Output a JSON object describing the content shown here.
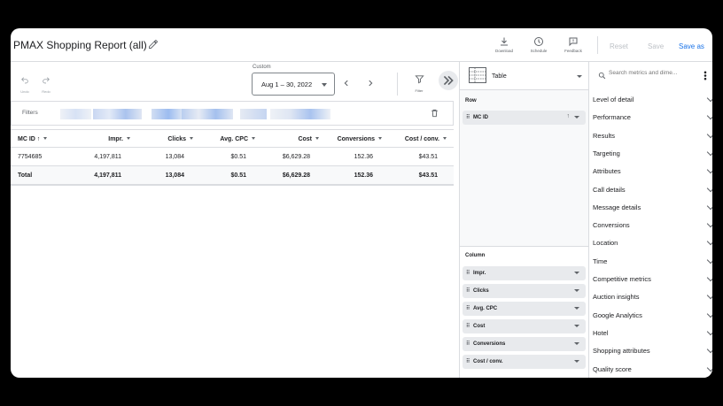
{
  "header": {
    "title": "PMAX Shopping Report (all)",
    "download_label": "Download",
    "schedule_label": "Schedule",
    "feedback_label": "Feedback",
    "reset_label": "Reset",
    "save_label": "Save",
    "save_as_label": "Save as"
  },
  "toolbar": {
    "undo_label": "Undo",
    "redo_label": "Redo",
    "custom_label": "Custom",
    "date_range": "Aug 1 – 30, 2022",
    "filter_label": "Filter"
  },
  "filters": {
    "label": "Filters"
  },
  "table": {
    "headers": [
      "MC ID",
      "Impr.",
      "Clicks",
      "Avg. CPC",
      "Cost",
      "Conversions",
      "Cost / conv."
    ],
    "rows": [
      [
        "7754685",
        "4,197,811",
        "13,084",
        "$0.51",
        "$6,629.28",
        "152.36",
        "$43.51"
      ]
    ],
    "total": [
      "Total",
      "4,197,811",
      "13,084",
      "$0.51",
      "$6,629.28",
      "152.36",
      "$43.51"
    ]
  },
  "panel": {
    "view_type": "Table",
    "row_section": "Row",
    "row_items": [
      "MC ID"
    ],
    "column_section": "Column",
    "column_items": [
      "Impr.",
      "Clicks",
      "Avg. CPC",
      "Cost",
      "Conversions",
      "Cost / conv."
    ]
  },
  "metrics": {
    "search_placeholder": "Search metrics and dime...",
    "categories": [
      "Level of detail",
      "Performance",
      "Results",
      "Targeting",
      "Attributes",
      "Call details",
      "Message details",
      "Conversions",
      "Location",
      "Time",
      "Competitive metrics",
      "Auction insights",
      "Google Analytics",
      "Hotel",
      "Shopping attributes",
      "Quality score"
    ]
  },
  "colors": {
    "accent": "#1a73e8",
    "border": "#dadce0",
    "muted": "#5f6368"
  }
}
